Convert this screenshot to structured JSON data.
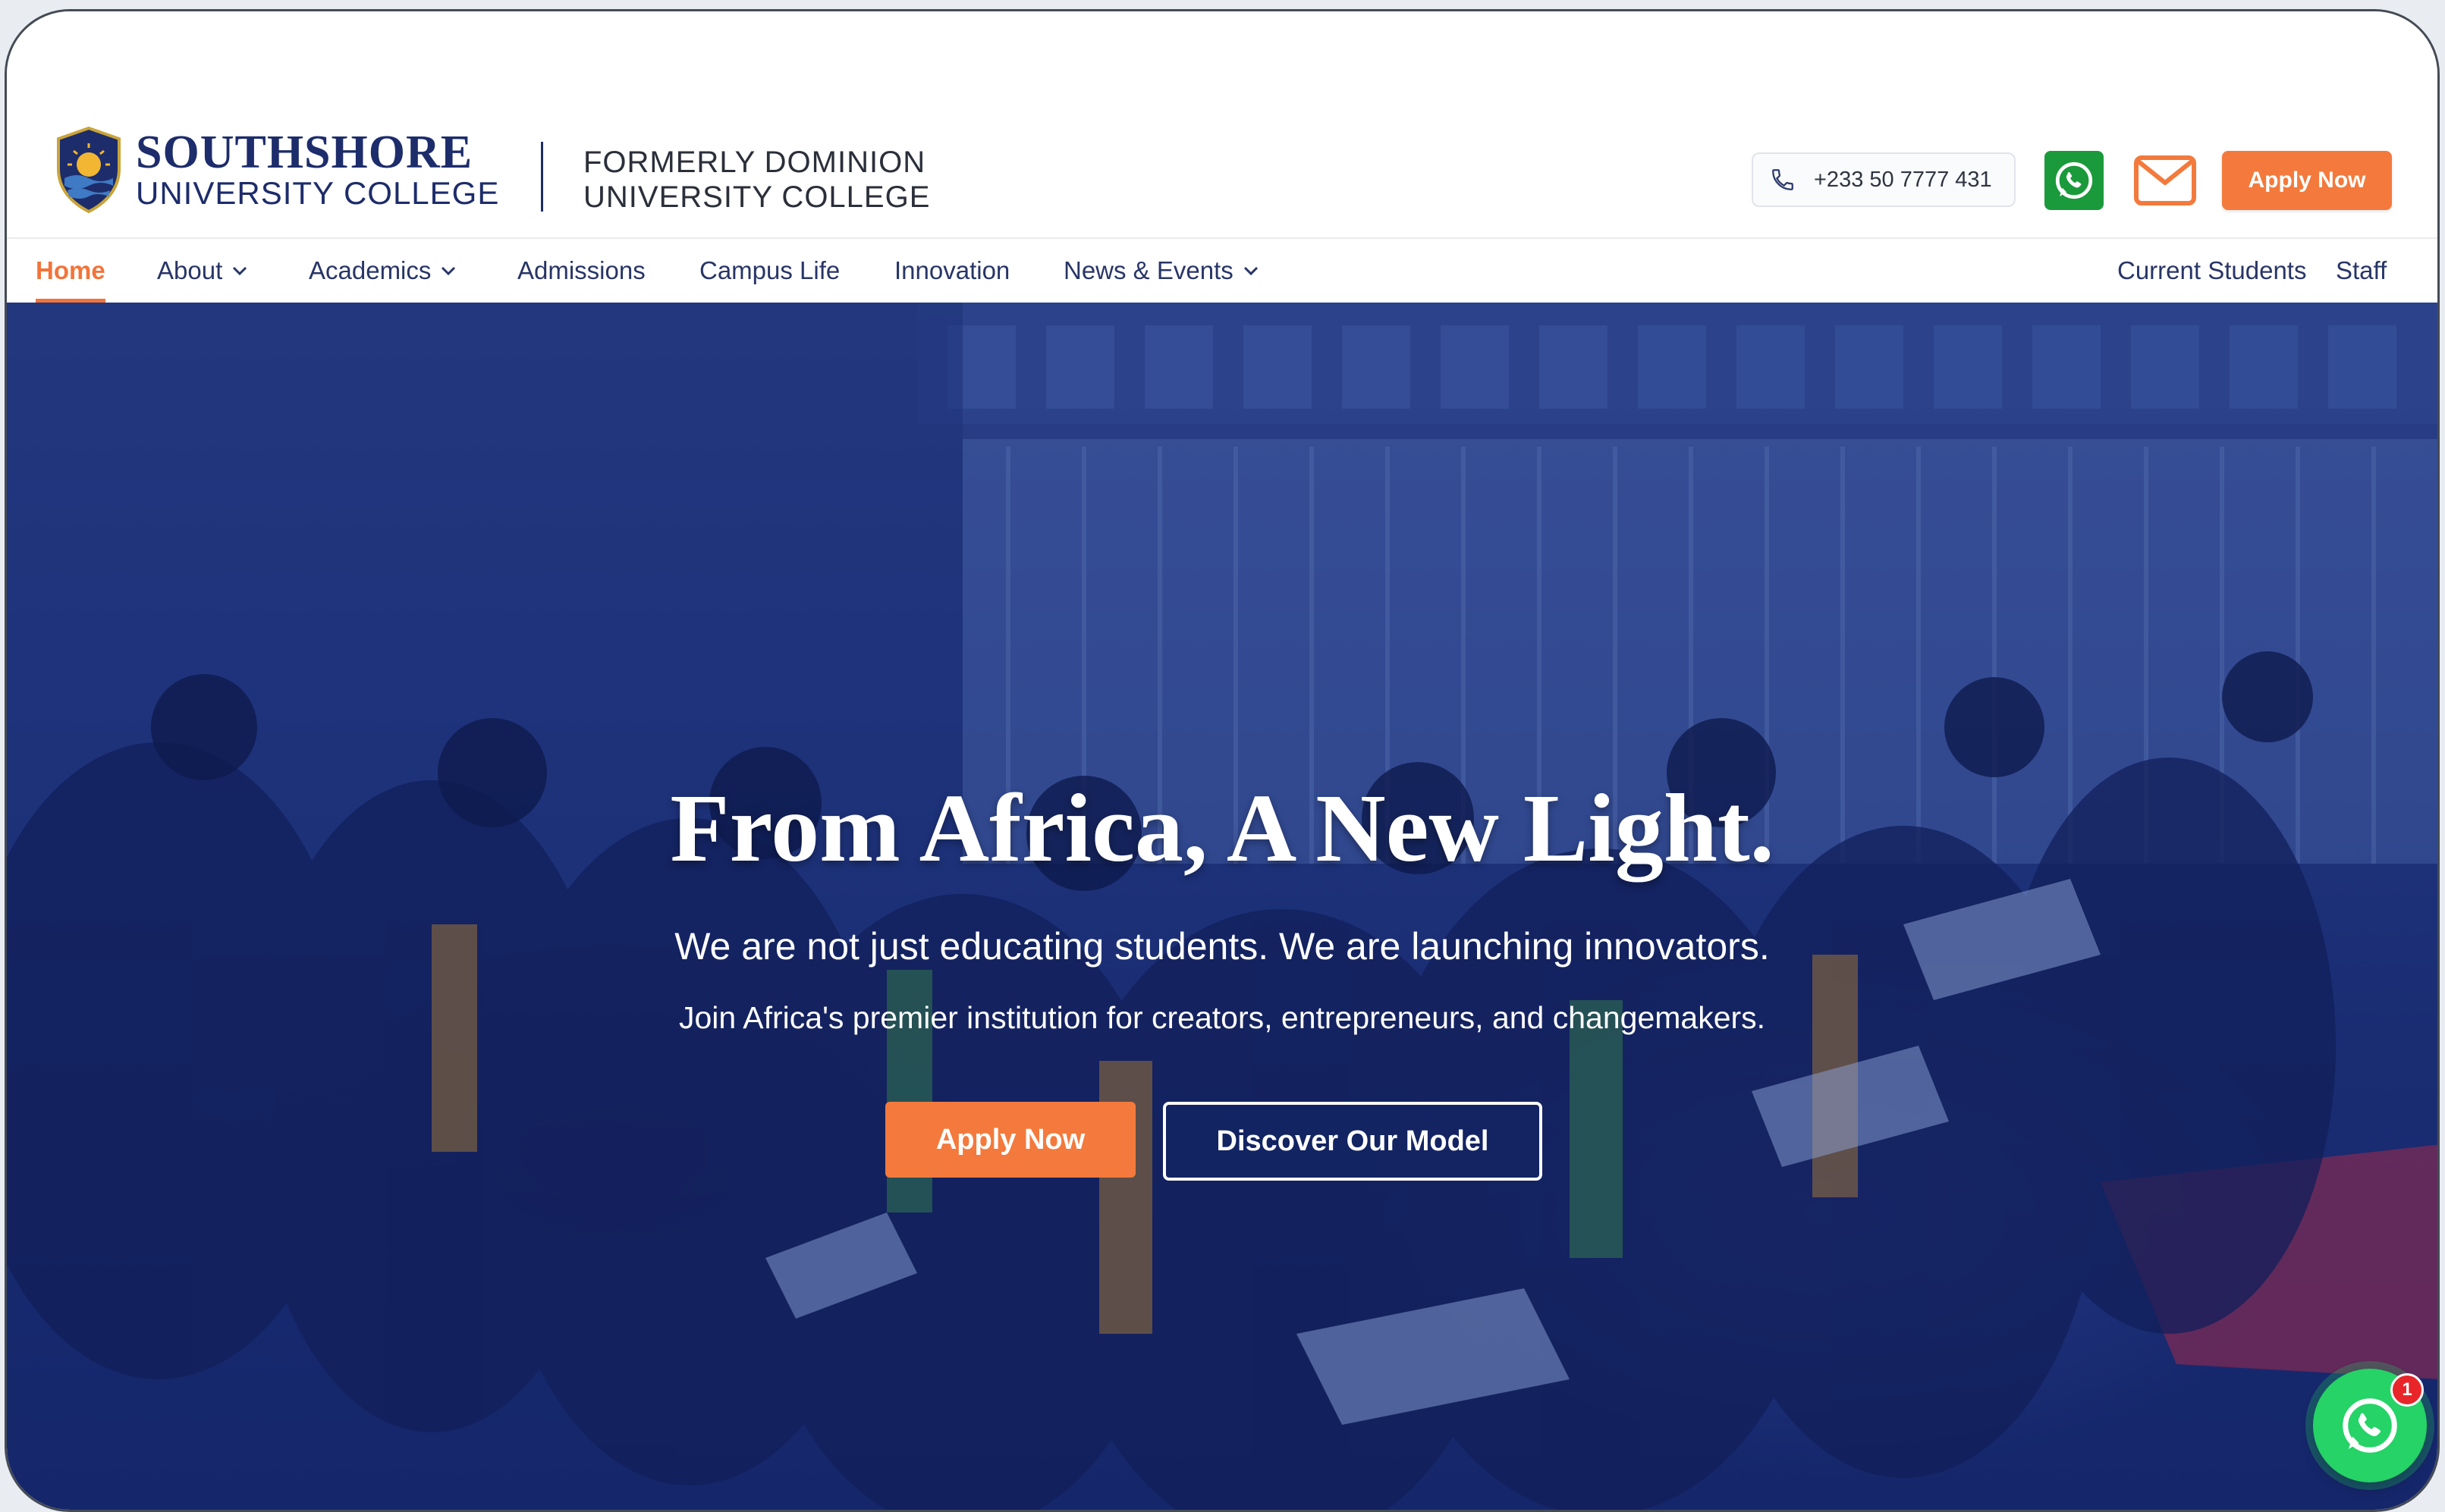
{
  "brand": {
    "name": "SOUTHSHORE",
    "subtitle": "UNIVERSITY COLLEGE",
    "formerly_line1": "FORMERLY DOMINION",
    "formerly_line2": "UNIVERSITY COLLEGE",
    "primary_color": "#1d2c6b",
    "accent_color": "#f37a3c"
  },
  "header": {
    "phone": "+233 50 7777 431",
    "phone_icon": "phone-icon",
    "whatsapp_icon": "whatsapp-icon",
    "mail_icon": "mail-icon",
    "apply_label": "Apply Now"
  },
  "nav": {
    "items": [
      {
        "label": "Home",
        "active": true,
        "dropdown": false
      },
      {
        "label": "About",
        "active": false,
        "dropdown": true
      },
      {
        "label": "Academics",
        "active": false,
        "dropdown": true
      },
      {
        "label": "Admissions",
        "active": false,
        "dropdown": false
      },
      {
        "label": "Campus Life",
        "active": false,
        "dropdown": false
      },
      {
        "label": "Innovation",
        "active": false,
        "dropdown": false
      },
      {
        "label": "News & Events",
        "active": false,
        "dropdown": true
      }
    ],
    "right_items": [
      {
        "label": "Current Students"
      },
      {
        "label": "Staff"
      }
    ]
  },
  "hero": {
    "title": "From Africa, A New Light.",
    "subtitle": "We are not just educating students. We are launching innovators.",
    "tagline": "Join Africa's premier institution for creators, entrepreneurs, and changemakers.",
    "primary_button": "Apply Now",
    "secondary_button": "Discover Our Model",
    "overlay_color": "#1a2d73"
  },
  "chat_widget": {
    "icon": "whatsapp-icon",
    "badge_count": "1"
  }
}
